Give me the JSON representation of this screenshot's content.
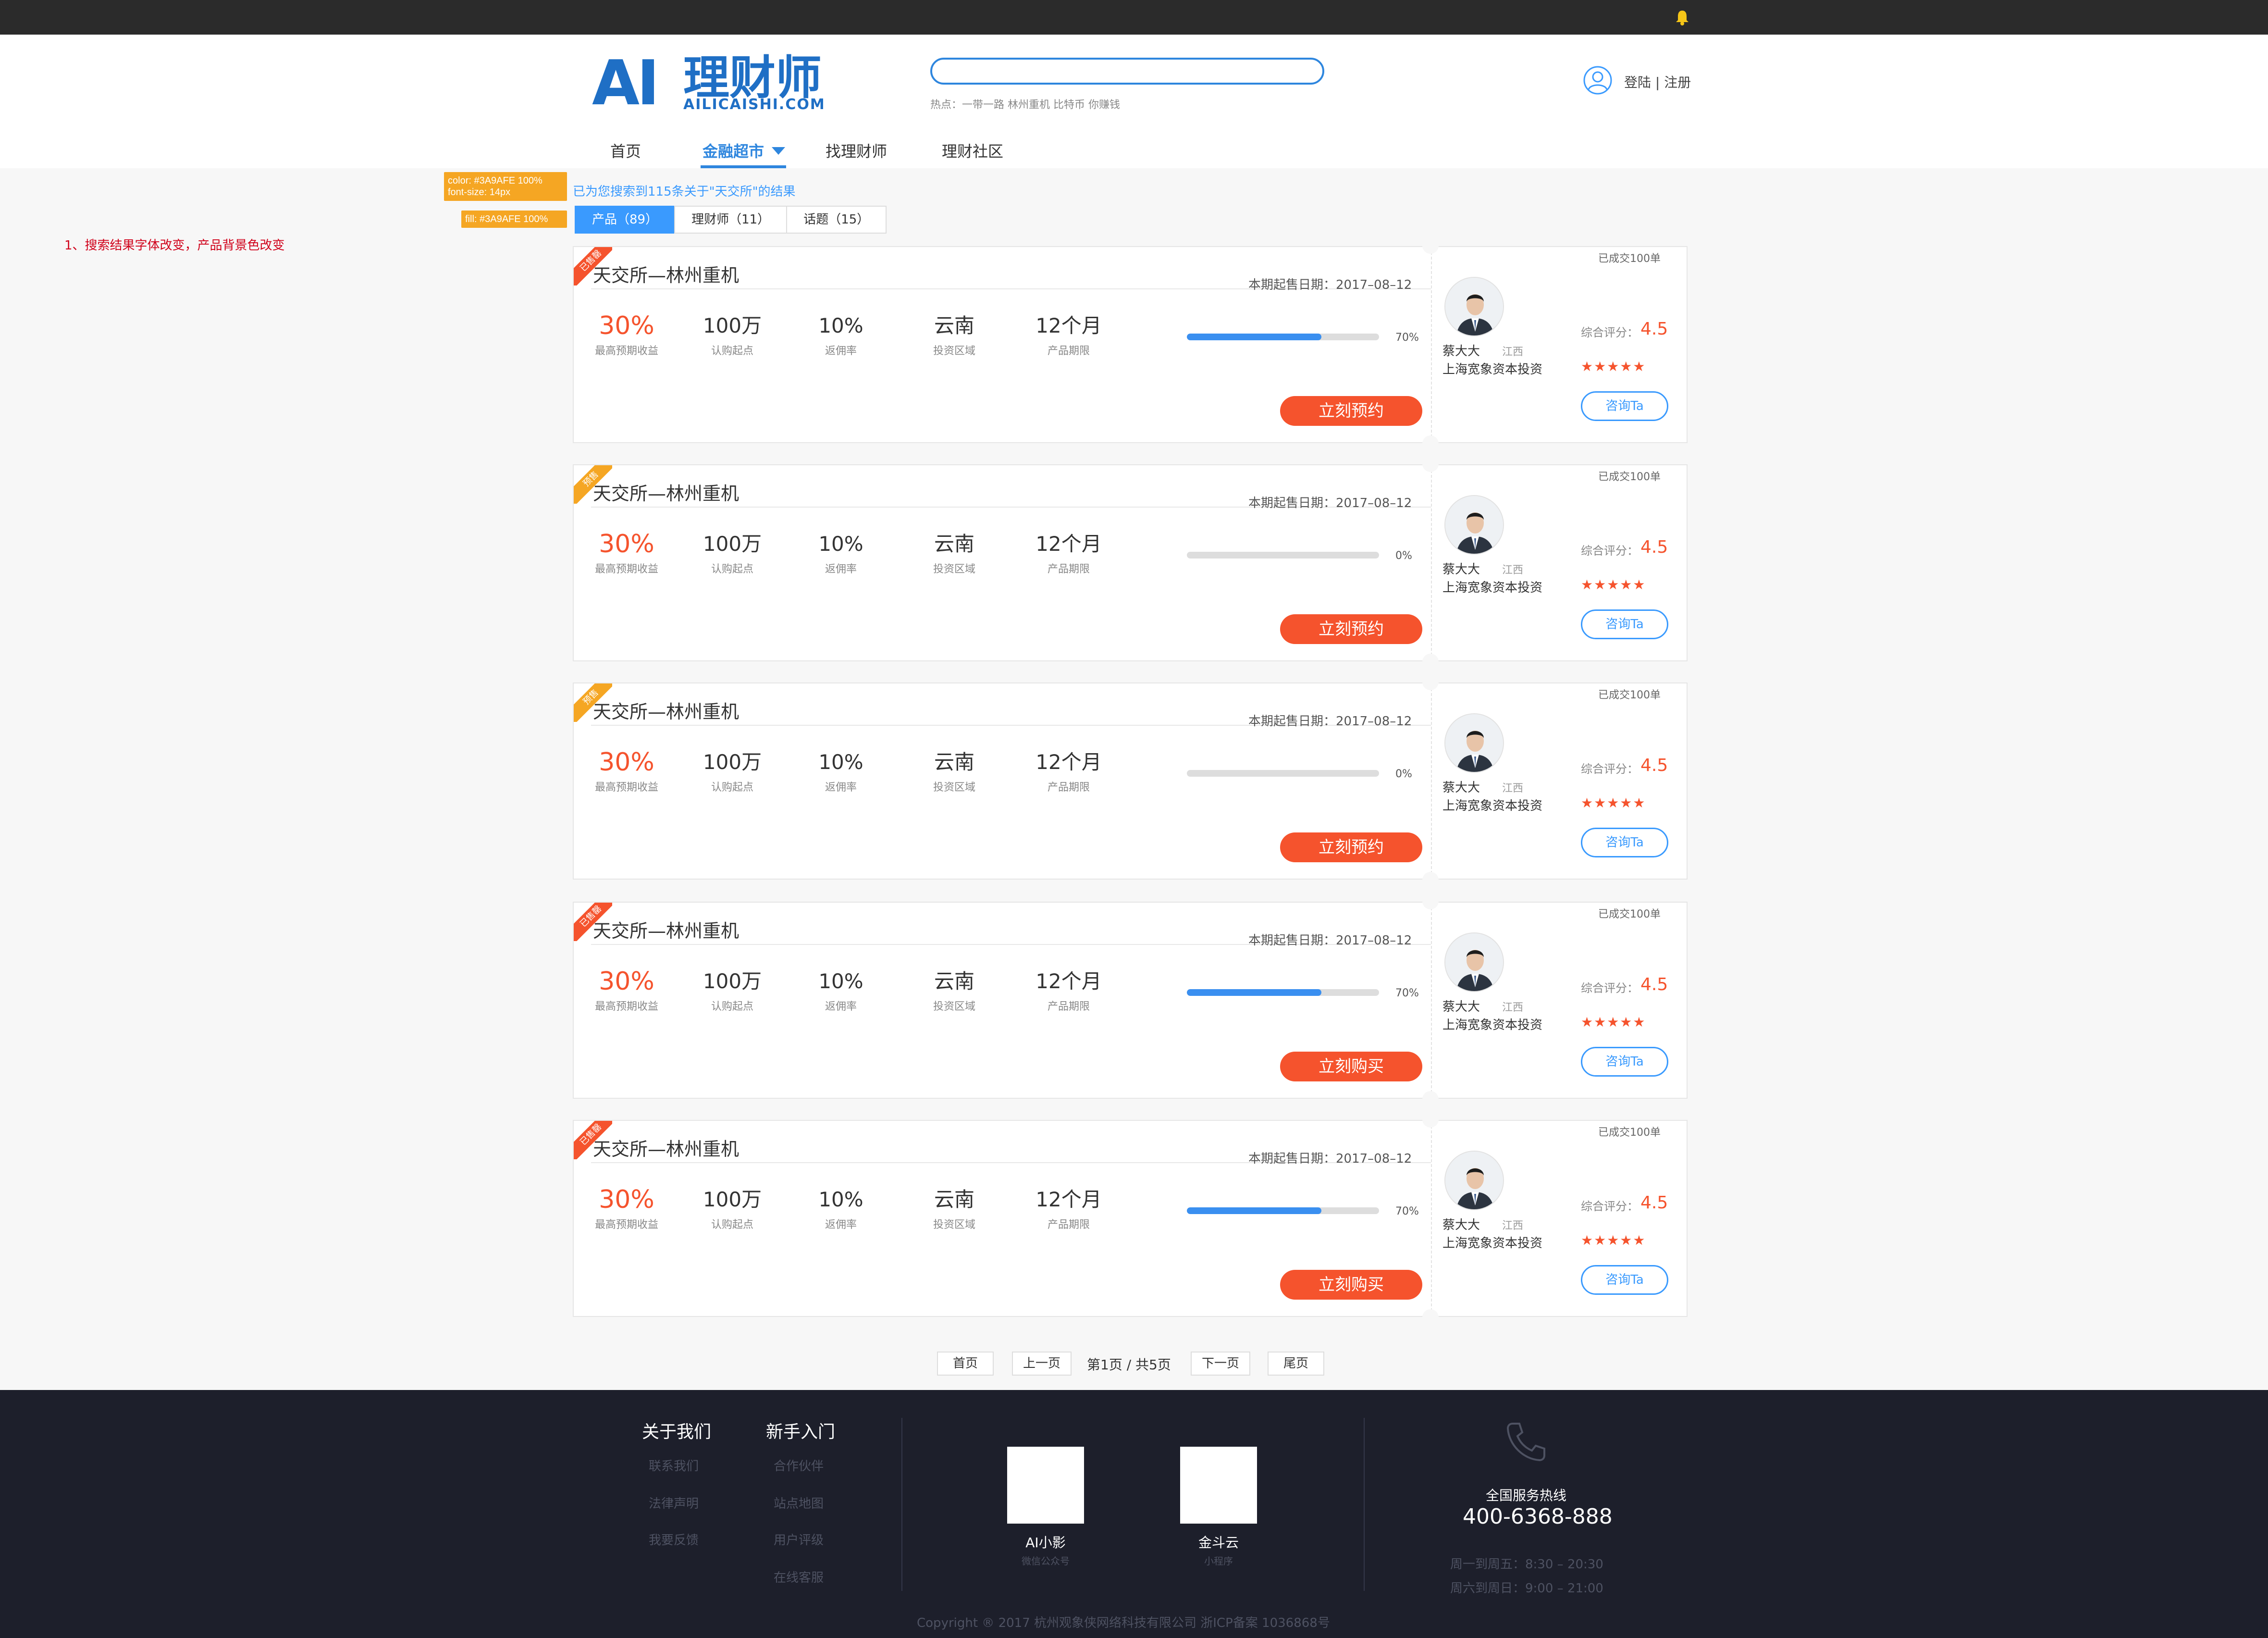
{
  "header": {
    "logo_big": "AI",
    "logo_cn": "理财师",
    "logo_en": "AILICAISHI.COM",
    "search_value": "",
    "hot_text": "热点：一带一路 林州重机 比特币 你赚钱",
    "login_text": "登陆 | 注册"
  },
  "nav": [
    {
      "label": "首页"
    },
    {
      "label": "金融超市"
    },
    {
      "label": "找理财师"
    },
    {
      "label": "理财社区"
    }
  ],
  "annotations": {
    "note1": "color: #3A9AFE 100%\nfont-size: 14px",
    "note2": "fill: #3A9AFE 100%",
    "red_note": "1、搜索结果字体改变，产品背景色改变"
  },
  "results_text": "已为您搜索到115条关于\"天交所\"的结果",
  "tabs": [
    {
      "label": "产品（89）"
    },
    {
      "label": "理财师（11）"
    },
    {
      "label": "话题（15）"
    }
  ],
  "cards": [
    {
      "ribbon": "已售罄",
      "ribbon_color": "#F5532D",
      "title": "天交所—林州重机",
      "sale_date": "本期起售日期：2017–08–12",
      "yield": "30%",
      "yield_label": "最高预期收益",
      "min": "100万",
      "min_label": "认购起点",
      "rebate": "10%",
      "rebate_label": "返佣率",
      "region": "云南",
      "region_label": "投资区域",
      "term": "12个月",
      "term_label": "产品期限",
      "progress": 70,
      "progress_text": "70%",
      "button": "立刻预约",
      "deals": "已成交100单",
      "advisor_name": "蔡大大",
      "advisor_region": "江西",
      "advisor_company": "上海宽象资本投资",
      "score_label": "综合评分：",
      "score": "4.5",
      "stars": "★★★★★",
      "consult": "咨询Ta"
    },
    {
      "ribbon": "预售",
      "ribbon_color": "#F5A623",
      "title": "天交所—林州重机",
      "sale_date": "本期起售日期：2017–08–12",
      "yield": "30%",
      "yield_label": "最高预期收益",
      "min": "100万",
      "min_label": "认购起点",
      "rebate": "10%",
      "rebate_label": "返佣率",
      "region": "云南",
      "region_label": "投资区域",
      "term": "12个月",
      "term_label": "产品期限",
      "progress": 0,
      "progress_text": "0%",
      "button": "立刻预约",
      "deals": "已成交100单",
      "advisor_name": "蔡大大",
      "advisor_region": "江西",
      "advisor_company": "上海宽象资本投资",
      "score_label": "综合评分：",
      "score": "4.5",
      "stars": "★★★★★",
      "consult": "咨询Ta"
    },
    {
      "ribbon": "预售",
      "ribbon_color": "#F5A623",
      "title": "天交所—林州重机",
      "sale_date": "本期起售日期：2017–08–12",
      "yield": "30%",
      "yield_label": "最高预期收益",
      "min": "100万",
      "min_label": "认购起点",
      "rebate": "10%",
      "rebate_label": "返佣率",
      "region": "云南",
      "region_label": "投资区域",
      "term": "12个月",
      "term_label": "产品期限",
      "progress": 0,
      "progress_text": "0%",
      "button": "立刻预约",
      "deals": "已成交100单",
      "advisor_name": "蔡大大",
      "advisor_region": "江西",
      "advisor_company": "上海宽象资本投资",
      "score_label": "综合评分：",
      "score": "4.5",
      "stars": "★★★★★",
      "consult": "咨询Ta"
    },
    {
      "ribbon": "已售罄",
      "ribbon_color": "#F5532D",
      "title": "天交所—林州重机",
      "sale_date": "本期起售日期：2017–08–12",
      "yield": "30%",
      "yield_label": "最高预期收益",
      "min": "100万",
      "min_label": "认购起点",
      "rebate": "10%",
      "rebate_label": "返佣率",
      "region": "云南",
      "region_label": "投资区域",
      "term": "12个月",
      "term_label": "产品期限",
      "progress": 70,
      "progress_text": "70%",
      "button": "立刻购买",
      "deals": "已成交100单",
      "advisor_name": "蔡大大",
      "advisor_region": "江西",
      "advisor_company": "上海宽象资本投资",
      "score_label": "综合评分：",
      "score": "4.5",
      "stars": "★★★★★",
      "consult": "咨询Ta"
    },
    {
      "ribbon": "已售罄",
      "ribbon_color": "#F5532D",
      "title": "天交所—林州重机",
      "sale_date": "本期起售日期：2017–08–12",
      "yield": "30%",
      "yield_label": "最高预期收益",
      "min": "100万",
      "min_label": "认购起点",
      "rebate": "10%",
      "rebate_label": "返佣率",
      "region": "云南",
      "region_label": "投资区域",
      "term": "12个月",
      "term_label": "产品期限",
      "progress": 70,
      "progress_text": "70%",
      "button": "立刻购买",
      "deals": "已成交100单",
      "advisor_name": "蔡大大",
      "advisor_region": "江西",
      "advisor_company": "上海宽象资本投资",
      "score_label": "综合评分：",
      "score": "4.5",
      "stars": "★★★★★",
      "consult": "咨询Ta"
    }
  ],
  "pager": {
    "first": "首页",
    "prev": "上一页",
    "info": "第1页 / 共5页",
    "next": "下一页",
    "last": "尾页"
  },
  "footer": {
    "about_title": "关于我们",
    "about_links": [
      "联系我们",
      "法律声明",
      "我要反馈"
    ],
    "newbie_title": "新手入门",
    "newbie_links": [
      "合作伙伴",
      "站点地图",
      "用户评级",
      "在线客服"
    ],
    "qr1_name": "AI小影",
    "qr1_sub": "微信公众号",
    "qr2_name": "金斗云",
    "qr2_sub": "小程序",
    "hotline_label": "全国服务热线",
    "hotline": "400-6368-888",
    "hours1": "周一到周五：8:30 – 20:30",
    "hours2": "周六到周日：9:00 – 21:00",
    "copyright": "Copyright ® 2017 杭州观象侠网络科技有限公司 浙ICP备案 1036868号"
  }
}
